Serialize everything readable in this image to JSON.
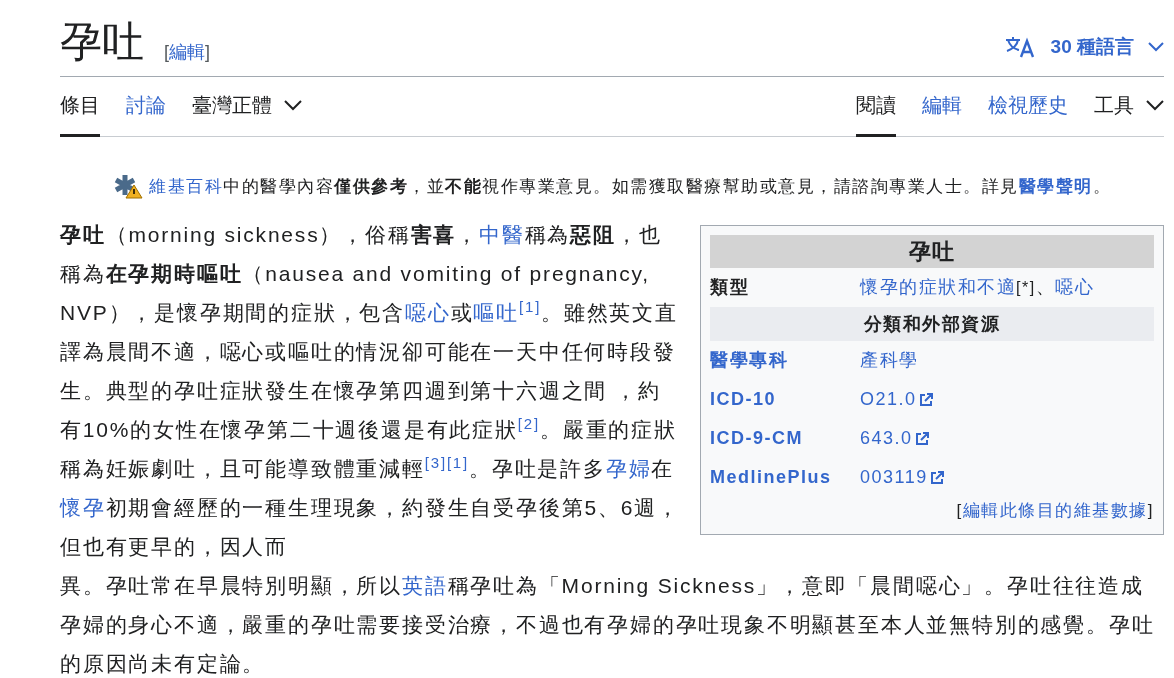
{
  "title": "孕吐",
  "title_edit": [
    {
      "kind": "text",
      "text": "["
    },
    {
      "kind": "link",
      "text": "編輯"
    },
    {
      "kind": "text",
      "text": "]"
    }
  ],
  "languages": "30 種語言",
  "tabs_left": [
    {
      "label": "條目",
      "kind": "tab",
      "selected": true
    },
    {
      "label": "討論",
      "kind": "tab",
      "selected": false
    },
    {
      "label": "臺灣正體",
      "kind": "dropdown",
      "selected": false
    }
  ],
  "tabs_right": [
    {
      "label": "閱讀",
      "kind": "tab",
      "selected": true
    },
    {
      "label": "編輯",
      "kind": "tab",
      "selected": false
    },
    {
      "label": "檢視歷史",
      "kind": "tab",
      "selected": false
    },
    {
      "label": "工具",
      "kind": "dropdown",
      "selected": false
    }
  ],
  "notice": [
    {
      "kind": "link",
      "text": "維基百科"
    },
    {
      "kind": "text",
      "text": "中的醫學內容"
    },
    {
      "kind": "bold",
      "text": "僅供參考"
    },
    {
      "kind": "text",
      "text": "，並"
    },
    {
      "kind": "bold",
      "text": "不能"
    },
    {
      "kind": "text",
      "text": "視作專業意見。如需獲取醫療幫助或意見，請諮詢專業人士。詳見"
    },
    {
      "kind": "boldlink",
      "text": "醫學聲明"
    },
    {
      "kind": "text",
      "text": "。"
    }
  ],
  "paragraph": {
    "beside_infobox": [
      {
        "kind": "bold",
        "text": "孕吐"
      },
      {
        "kind": "text",
        "text": "（morning sickness），俗稱"
      },
      {
        "kind": "bold",
        "text": "害喜"
      },
      {
        "kind": "text",
        "text": "，"
      },
      {
        "kind": "link",
        "text": "中醫"
      },
      {
        "kind": "text",
        "text": "稱為"
      },
      {
        "kind": "bold",
        "text": "惡阻"
      },
      {
        "kind": "text",
        "text": "，也稱為"
      },
      {
        "kind": "bold",
        "text": "在孕期時嘔吐"
      },
      {
        "kind": "text",
        "text": "（nausea and vomiting of pregnancy, NVP），是懷孕期間的症狀，包含"
      },
      {
        "kind": "link",
        "text": "噁心"
      },
      {
        "kind": "text",
        "text": "或"
      },
      {
        "kind": "link",
        "text": "嘔吐"
      },
      {
        "kind": "ref",
        "text": "[1]"
      },
      {
        "kind": "text",
        "text": "。雖然英文直譯為晨間不適，噁心或嘔吐的情況卻可能在一天中任何時段發生。典型的孕吐症狀發生在懷孕第四週到第十六週之間 ，約有10%的女性在懷孕第二十週後還是有此症狀"
      },
      {
        "kind": "ref",
        "text": "[2]"
      },
      {
        "kind": "text",
        "text": "。嚴重的症狀稱為妊娠劇吐，且可能導致體重減輕"
      },
      {
        "kind": "ref",
        "text": "[3]"
      },
      {
        "kind": "ref",
        "text": "[1]"
      },
      {
        "kind": "text",
        "text": "。孕吐是許多"
      },
      {
        "kind": "link",
        "text": "孕婦"
      },
      {
        "kind": "text",
        "text": "在"
      },
      {
        "kind": "link",
        "text": "懷孕"
      },
      {
        "kind": "text",
        "text": "初期會經歷的一種生理現象，約發生自受孕後第5、6週，但也有更早的，因人而"
      }
    ],
    "below_infobox": [
      {
        "kind": "text",
        "text": "異。孕吐常在早晨特別明顯，所以"
      },
      {
        "kind": "link",
        "text": "英語"
      },
      {
        "kind": "text",
        "text": "稱孕吐為「Morning Sickness」，意即「晨間噁心」。孕吐往往造成孕婦的身心不適，嚴重的孕吐需要接受治療，不過也有孕婦的孕吐現象不明顯甚至本人並無特別的感覺。孕吐的原因尚未有定論。"
      }
    ]
  },
  "infobox": {
    "title": "孕吐",
    "rows": [
      {
        "kind": "row",
        "label": "類型",
        "label_link": false,
        "value": [
          {
            "kind": "link",
            "text": "懷孕的症狀和不適"
          },
          {
            "kind": "note",
            "text": "[*]"
          },
          {
            "kind": "text",
            "text": "、"
          },
          {
            "kind": "link",
            "text": "噁心"
          }
        ]
      },
      {
        "kind": "section",
        "label": "分類和外部資源"
      },
      {
        "kind": "row",
        "label": "醫學專科",
        "label_link": true,
        "value": [
          {
            "kind": "link",
            "text": "產科學"
          }
        ]
      },
      {
        "kind": "row",
        "label": "ICD-10",
        "label_link": true,
        "value": [
          {
            "kind": "extlink",
            "text": "O21.0"
          }
        ]
      },
      {
        "kind": "row",
        "label": "ICD-9-CM",
        "label_link": true,
        "value": [
          {
            "kind": "extlink",
            "text": "643.0"
          }
        ]
      },
      {
        "kind": "row",
        "label": "MedlinePlus",
        "label_link": true,
        "value": [
          {
            "kind": "extlink",
            "text": "003119"
          }
        ]
      }
    ],
    "footer": [
      {
        "kind": "text",
        "text": "["
      },
      {
        "kind": "link",
        "text": "編輯此條目的維基數據"
      },
      {
        "kind": "text",
        "text": "]"
      }
    ]
  }
}
